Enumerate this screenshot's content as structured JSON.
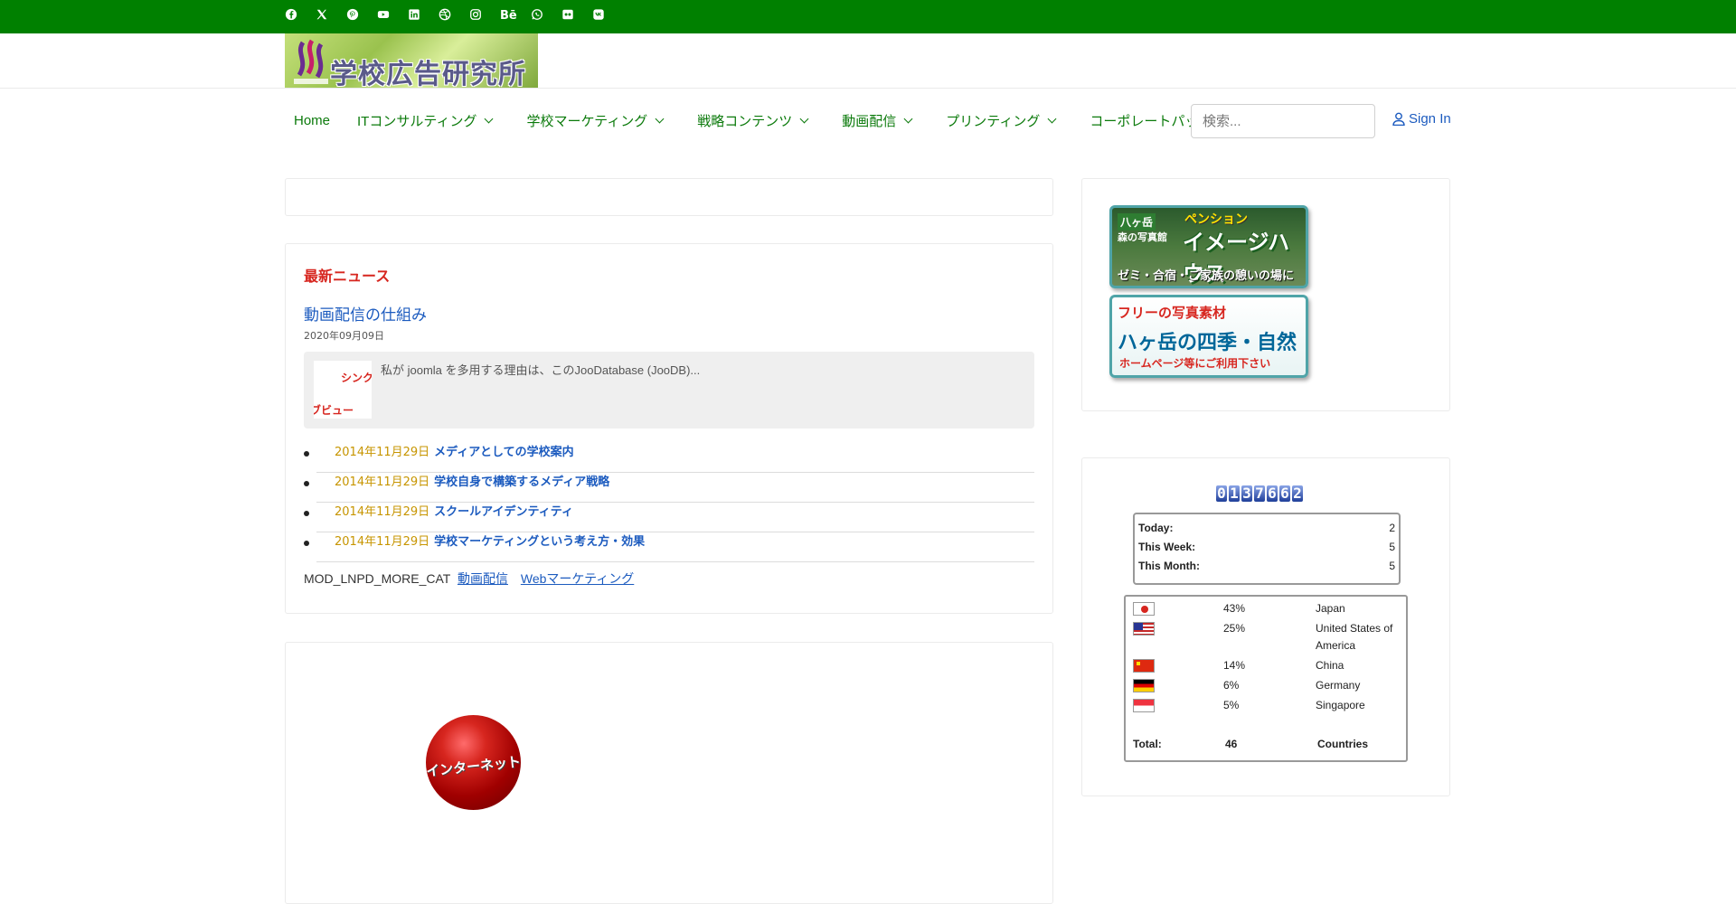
{
  "social": [
    "facebook-icon",
    "x-icon",
    "pinterest-icon",
    "youtube-icon",
    "linkedin-icon",
    "dribbble-icon",
    "instagram-icon",
    "behance-icon",
    "whatsapp-icon",
    "flickr-icon",
    "vk-icon"
  ],
  "colors": {
    "topbar": "#008000",
    "nav_link": "#0b7a0b",
    "link": "#1c5bbf",
    "news_title": "#d7261f",
    "date": "#c79500"
  },
  "header": {
    "logo_text": "学校広告研究所"
  },
  "nav": {
    "items": [
      "Home",
      "ITコンサルティング",
      "学校マーケティング",
      "戦略コンテンツ",
      "動画配信",
      "プリンティング",
      "コーポレートパッケージ"
    ],
    "search_placeholder": "検索...",
    "signin": "Sign In"
  },
  "news": {
    "title": "最新ニュース",
    "article_title": "動画配信の仕組み",
    "article_date": "2020年09月09日",
    "thumb_text1": "シンク",
    "thumb_text2": "ブビュー",
    "intro": "私が joomla を多用する理由は、このJooDatabase (JooDB)...",
    "list": [
      {
        "date": "2014年11月29日",
        "title": "メディアとしての学校案内"
      },
      {
        "date": "2014年11月29日",
        "title": "学校自身で構築するメディア戦略"
      },
      {
        "date": "2014年11月29日",
        "title": "スクールアイデンティティ"
      },
      {
        "date": "2014年11月29日",
        "title": "学校マーケティングという考え方・効果"
      }
    ],
    "more_label": "MOD_LNPD_MORE_CAT",
    "more_links": [
      "動画配信",
      "Webマーケティング"
    ]
  },
  "banner1": {
    "l1": "八ヶ岳",
    "l2": "森の写真館",
    "l3": "ペンション",
    "l4": "イメージハウス",
    "l5": "ゼミ・合宿・ご家族の憩いの場に"
  },
  "banner2": {
    "l1": "フリーの写真素材",
    "l2": "ハヶ岳の四季・自然",
    "l3": "ホームページ等にご利用下さい"
  },
  "internet_ball": "インターネット",
  "counter": {
    "digits": "0137662",
    "today_label": "Today:",
    "today": "2",
    "week_label": "This Week:",
    "week": "5",
    "month_label": "This Month:",
    "month": "5"
  },
  "geo": {
    "rows": [
      {
        "pct": "43%",
        "country": "Japan"
      },
      {
        "pct": "25%",
        "country": "United States of America"
      },
      {
        "pct": "14%",
        "country": "China"
      },
      {
        "pct": "6%",
        "country": "Germany"
      },
      {
        "pct": "5%",
        "country": "Singapore"
      }
    ],
    "total_label": "Total:",
    "total": "46",
    "countries_label": "Countries"
  }
}
